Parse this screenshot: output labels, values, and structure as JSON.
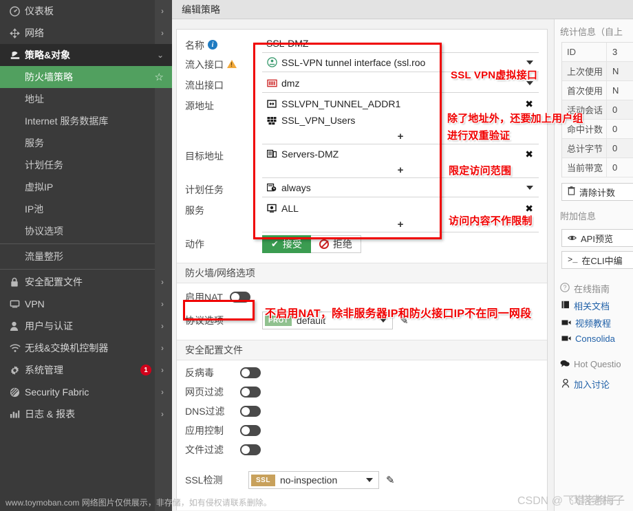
{
  "header": {
    "title": "编辑策略"
  },
  "sidebar": {
    "items": [
      {
        "label": "仪表板",
        "icon": "dashboard-icon",
        "arrow": "›",
        "state": "collapsed"
      },
      {
        "label": "网络",
        "icon": "network-icon",
        "arrow": "›",
        "state": "collapsed"
      },
      {
        "label": "策略&对象",
        "icon": "policy-icon",
        "arrow": "⌄",
        "state": "expanded"
      }
    ],
    "sub_items": [
      {
        "label": "防火墙策略",
        "active": true,
        "star": "☆"
      },
      {
        "label": "地址",
        "active": false
      },
      {
        "label": "Internet 服务数据库",
        "active": false
      },
      {
        "label": "服务",
        "active": false
      },
      {
        "label": "计划任务",
        "active": false
      },
      {
        "label": "虚拟IP",
        "active": false
      },
      {
        "label": "IP池",
        "active": false
      },
      {
        "label": "协议选项",
        "active": false
      },
      {
        "label": "流量整形",
        "active": false
      }
    ],
    "items_bottom": [
      {
        "label": "安全配置文件",
        "icon": "lock-icon",
        "arrow": "›"
      },
      {
        "label": "VPN",
        "icon": "monitor-icon",
        "arrow": "›"
      },
      {
        "label": "用户与认证",
        "icon": "user-icon",
        "arrow": "›"
      },
      {
        "label": "无线&交换机控制器",
        "icon": "wifi-icon",
        "arrow": "›"
      },
      {
        "label": "系统管理",
        "icon": "gear-icon",
        "arrow": "›",
        "badge": "1"
      },
      {
        "label": "Security Fabric",
        "icon": "fabric-icon",
        "arrow": "›"
      },
      {
        "label": "日志 & 报表",
        "icon": "chart-icon",
        "arrow": "›"
      }
    ]
  },
  "form": {
    "name": {
      "label": "名称",
      "value": "SSL-DMZ"
    },
    "incoming_interface": {
      "label": "流入接口",
      "value": "SSL-VPN tunnel interface (ssl.roo",
      "icon": "ssl-vpn-tunnel-icon"
    },
    "outgoing_interface": {
      "label": "流出接口",
      "value": "dmz",
      "icon": "dmz-port-icon"
    },
    "source": {
      "label": "源地址",
      "chips": [
        {
          "text": "SSLVPN_TUNNEL_ADDR1",
          "icon": "address-range-icon"
        },
        {
          "text": "SSL_VPN_Users",
          "icon": "user-group-icon"
        }
      ],
      "add": "+"
    },
    "destination": {
      "label": "目标地址",
      "chips": [
        {
          "text": "Servers-DMZ",
          "icon": "address-group-icon"
        }
      ],
      "add": "+"
    },
    "schedule": {
      "label": "计划任务",
      "value": "always",
      "icon": "schedule-clock-icon"
    },
    "service": {
      "label": "服务",
      "chips": [
        {
          "text": "ALL",
          "icon": "service-icon"
        }
      ],
      "add": "+"
    },
    "action": {
      "label": "动作",
      "accept": "接受",
      "deny": "拒绝",
      "selected": "接受"
    },
    "firewall_section": {
      "title": "防火墙/网络选项"
    },
    "nat": {
      "label": "启用NAT",
      "enabled": false
    },
    "protocol_options": {
      "label": "协议选项",
      "value": "default",
      "tag": "PROT"
    },
    "security_section": {
      "title": "安全配置文件"
    },
    "profiles": [
      {
        "label": "反病毒",
        "enabled": false
      },
      {
        "label": "网页过滤",
        "enabled": false
      },
      {
        "label": "DNS过滤",
        "enabled": false
      },
      {
        "label": "应用控制",
        "enabled": false
      },
      {
        "label": "文件过滤",
        "enabled": false
      }
    ],
    "ssl_inspection": {
      "label": "SSL检测",
      "value": "no-inspection",
      "tag": "SSL"
    }
  },
  "right_panel": {
    "stats_title": "统计信息（自上",
    "rows": [
      {
        "key": "ID",
        "value": "3"
      },
      {
        "key": "上次使用",
        "value": "N"
      },
      {
        "key": "首次使用",
        "value": "N"
      },
      {
        "key": "活动会话",
        "value": "0"
      },
      {
        "key": "命中计数",
        "value": "0"
      },
      {
        "key": "总计字节",
        "value": "0"
      },
      {
        "key": "当前带宽",
        "value": "0"
      }
    ],
    "clear_counters": "清除计数",
    "extra_title": "附加信息",
    "api_preview": "API预览",
    "cli_edit": "在CLI中编",
    "online_guide": "在线指南",
    "links": [
      {
        "label": "相关文档",
        "icon": "book-icon"
      },
      {
        "label": "视频教程",
        "icon": "video-icon"
      },
      {
        "label": "Consolida",
        "icon": "video-icon"
      }
    ],
    "hot_questions": "Hot Questio",
    "join_discussion": "加入讨论"
  },
  "annotations": [
    {
      "id": "annot-ssl-vpn-interface",
      "text": "SSL VPN虚拟接口"
    },
    {
      "id": "annot-user-group-line1",
      "text": "除了地址外，还要加上用户组"
    },
    {
      "id": "annot-user-group-line2",
      "text": "进行双重验证"
    },
    {
      "id": "annot-scope",
      "text": "限定访问范围"
    },
    {
      "id": "annot-content",
      "text": "访问内容不作限制"
    },
    {
      "id": "annot-nat",
      "text": "不启用NAT，除非服务器IP和防火接口IP不在同一网段"
    }
  ],
  "watermarks": {
    "toymoban": "www.toymoban.com 网络图片仅供展示，非存储，如有侵权请联系删除。",
    "csdn": "CSDN @飞塔老梅子",
    "corner": "飞塔老梅子"
  },
  "colors": {
    "accent_green": "#4e9a5e",
    "annotation_red": "#f00000",
    "sidebar_bg": "#3a3a3a",
    "badge_red": "#d0021b"
  }
}
